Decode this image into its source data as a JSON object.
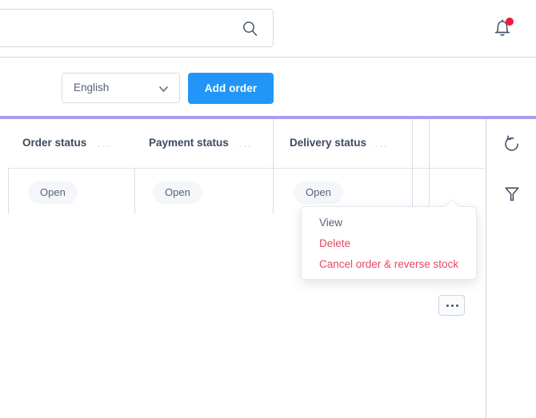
{
  "topbar": {
    "search": {
      "value": "",
      "placeholder": "",
      "icon": "search-icon"
    },
    "notifications": {
      "icon": "bell-icon",
      "badge_color": "#ed1c3c",
      "has_unread": true
    }
  },
  "actionbar": {
    "language_select": {
      "value": "English",
      "icon": "chevron-down-icon"
    },
    "add_order_button": {
      "label": "Add order",
      "color": "#2196f8"
    },
    "divider_color": "#a79ef2"
  },
  "table": {
    "columns": [
      {
        "label": "Order status",
        "menu_icon": "ellipsis-icon"
      },
      {
        "label": "Payment status",
        "menu_icon": "ellipsis-icon"
      },
      {
        "label": "Delivery status",
        "menu_icon": "ellipsis-icon"
      }
    ],
    "column_menu_glyph": "···",
    "rows": [
      {
        "order_status": "Open",
        "payment_status": "Open",
        "delivery_status": "Open",
        "row_action_glyph": "•••"
      }
    ],
    "header_action": {
      "icon": "hamburger-icon"
    }
  },
  "context_menu": {
    "items": [
      {
        "label": "View",
        "color": "#56637a"
      },
      {
        "label": "Delete",
        "color": "#e8465f"
      },
      {
        "label": "Cancel order & reverse stock",
        "color": "#e8465f"
      }
    ]
  },
  "right_rail": {
    "buttons": [
      {
        "icon": "refresh-icon"
      },
      {
        "icon": "filter-icon"
      }
    ]
  }
}
